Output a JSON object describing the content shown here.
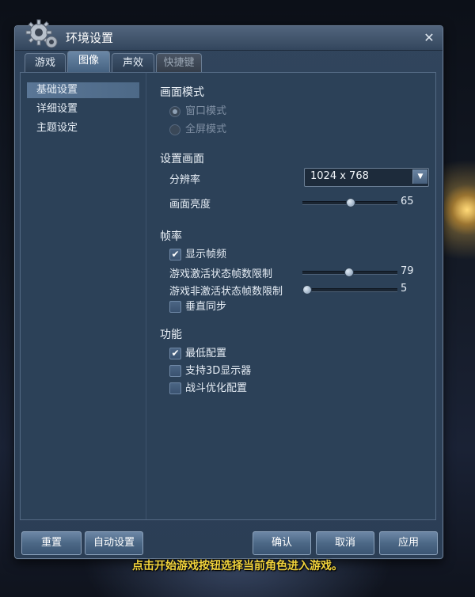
{
  "window": {
    "title": "环境设置"
  },
  "tabs": [
    {
      "label": "游戏",
      "state": "normal"
    },
    {
      "label": "图像",
      "state": "active"
    },
    {
      "label": "声效",
      "state": "normal"
    },
    {
      "label": "快捷键",
      "state": "disabled"
    }
  ],
  "sidebar": {
    "items": [
      {
        "label": "基础设置",
        "active": true
      },
      {
        "label": "详细设置",
        "active": false
      },
      {
        "label": "主题设定",
        "active": false
      }
    ]
  },
  "display_mode": {
    "title": "画面模式",
    "options": [
      {
        "label": "窗口模式",
        "selected": true,
        "disabled": true
      },
      {
        "label": "全屏模式",
        "selected": false,
        "disabled": true
      }
    ]
  },
  "screen": {
    "title": "设置画面",
    "resolution_label": "分辨率",
    "resolution_value": "1024 x  768",
    "brightness_label": "画面亮度",
    "brightness": {
      "value": "65",
      "level": 0.5
    }
  },
  "framerate": {
    "title": "帧率",
    "show_fps": {
      "label": "显示帧频",
      "checked": true
    },
    "active_limit": {
      "label": "游戏激活状态帧数限制",
      "value": "79",
      "level": 0.48
    },
    "inactive_limit": {
      "label": "游戏非激活状态帧数限制",
      "value": "5",
      "level": 0.0
    },
    "vsync": {
      "label": "垂直同步",
      "checked": false
    }
  },
  "features": {
    "title": "功能",
    "options": [
      {
        "label": "最低配置",
        "checked": true
      },
      {
        "label": "支持3D显示器",
        "checked": false
      },
      {
        "label": "战斗优化配置",
        "checked": false
      }
    ]
  },
  "buttons": {
    "reset": "重置",
    "auto": "自动设置",
    "ok": "确认",
    "cancel": "取消",
    "apply": "应用"
  },
  "hint": "点击开始游戏按钮选择当前角色进入游戏。",
  "icons": {
    "settings": "gear-icon",
    "close": "close-icon",
    "check": "✔"
  },
  "colors": {
    "accent": "#4c6886",
    "hint": "#f1d33c",
    "panel": "#2c4158"
  }
}
